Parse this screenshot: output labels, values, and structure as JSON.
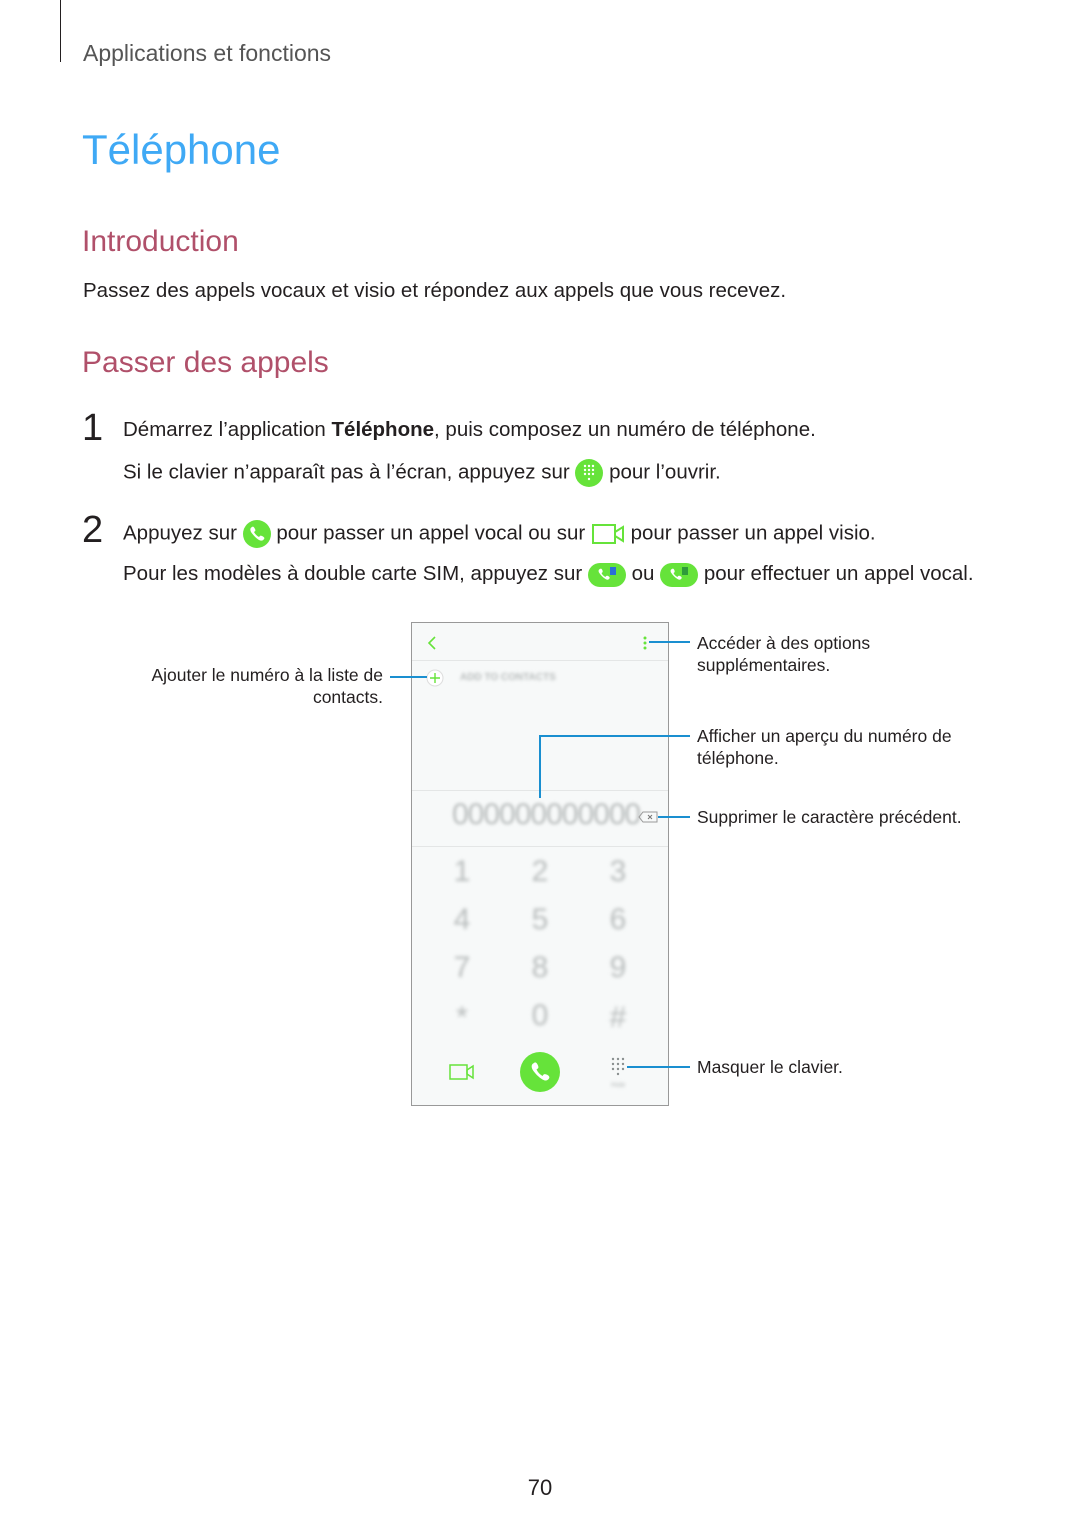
{
  "header": {
    "section": "Applications et fonctions"
  },
  "title": "Téléphone",
  "intro": {
    "heading": "Introduction",
    "text": "Passez des appels vocaux et visio et répondez aux appels que vous recevez."
  },
  "calls": {
    "heading": "Passer des appels",
    "steps": [
      {
        "number": "1",
        "line1_pre": "Démarrez l’application ",
        "line1_bold": "Téléphone",
        "line1_post": ", puis composez un numéro de téléphone.",
        "line2_pre": "Si le clavier n’apparaît pas à l’écran, appuyez sur ",
        "line2_post": " pour l’ouvrir."
      },
      {
        "number": "2",
        "line1_a": "Appuyez sur ",
        "line1_b": " pour passer un appel vocal ou sur ",
        "line1_c": " pour passer un appel visio.",
        "line2_a": "Pour les modèles à double carte SIM, appuyez sur ",
        "line2_b": " ou ",
        "line2_c": " pour effectuer un appel vocal."
      }
    ]
  },
  "phone": {
    "add_to_contacts": "ADD TO CONTACTS",
    "number": "000000000000",
    "keys": [
      [
        "1",
        "2",
        "3"
      ],
      [
        "4",
        "5",
        "6"
      ],
      [
        "7",
        "8",
        "9"
      ],
      [
        "*",
        "0",
        "#"
      ]
    ],
    "hide": "Hide"
  },
  "callouts": {
    "add_contact": "Ajouter le numéro à la liste de contacts.",
    "options": "Accéder à des options supplémentaires.",
    "preview": "Afficher un aperçu du numéro de téléphone.",
    "delete": "Supprimer le caractère précédent.",
    "hide_keypad": "Masquer le clavier."
  },
  "page_number": "70",
  "colors": {
    "title": "#3fa9f5",
    "heading": "#b0506a",
    "accent_green": "#66e33a",
    "callout_line": "#1a8fd0"
  }
}
